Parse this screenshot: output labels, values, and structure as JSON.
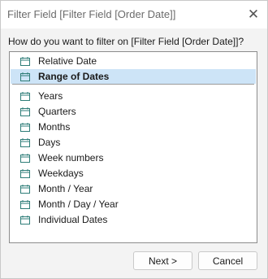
{
  "window": {
    "title": "Filter Field [Filter Field [Order Date]]"
  },
  "prompt": "How do you want to filter on [Filter Field [Order Date]]?",
  "options": {
    "group1": [
      {
        "label": "Relative Date",
        "icon": "calendar-icon",
        "selected": false
      },
      {
        "label": "Range of Dates",
        "icon": "calendar-icon",
        "selected": true
      }
    ],
    "group2": [
      {
        "label": "Years",
        "icon": "calendar-icon"
      },
      {
        "label": "Quarters",
        "icon": "calendar-icon"
      },
      {
        "label": "Months",
        "icon": "calendar-icon"
      },
      {
        "label": "Days",
        "icon": "calendar-icon"
      },
      {
        "label": "Week numbers",
        "icon": "calendar-icon"
      },
      {
        "label": "Weekdays",
        "icon": "calendar-icon"
      },
      {
        "label": "Month / Year",
        "icon": "calendar-icon"
      },
      {
        "label": "Month / Day / Year",
        "icon": "calendar-icon"
      },
      {
        "label": "Individual Dates",
        "icon": "calendar-icon"
      }
    ]
  },
  "buttons": {
    "next": "Next >",
    "cancel": "Cancel"
  },
  "colors": {
    "selection": "#cde4f7",
    "icon": "#2e7d78",
    "border": "#8c8c8c"
  }
}
